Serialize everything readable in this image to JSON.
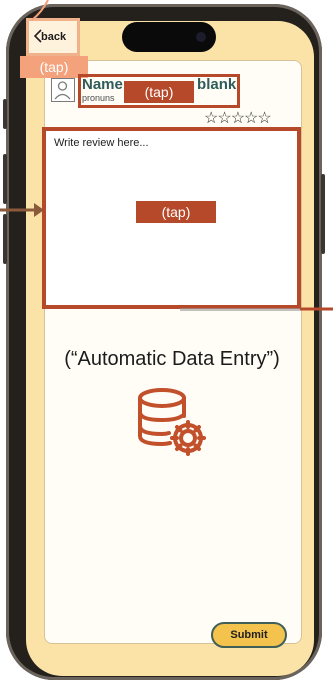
{
  "nav": {
    "back_label": "back",
    "back_tap_tag": "(tap)"
  },
  "profile": {
    "name_visible": "Name",
    "name_suffix": "blank",
    "pronouns_visible": "pronuns",
    "name_tap_tag": "(tap)",
    "rating": {
      "filled": 0,
      "max": 5,
      "stars": "☆☆☆☆☆"
    }
  },
  "review": {
    "placeholder": "Write review here...",
    "tap_tag": "(tap)"
  },
  "feature": {
    "title": "(“Automatic Data Entry”)",
    "icon": "database-gear-icon"
  },
  "actions": {
    "submit_label": "Submit"
  },
  "colors": {
    "screen_bg": "#fbe3a8",
    "annotation": "#b6492a",
    "annotation_light": "#f3a27c",
    "name_text": "#2f5d5b",
    "submit_bg": "#f4c34e"
  }
}
